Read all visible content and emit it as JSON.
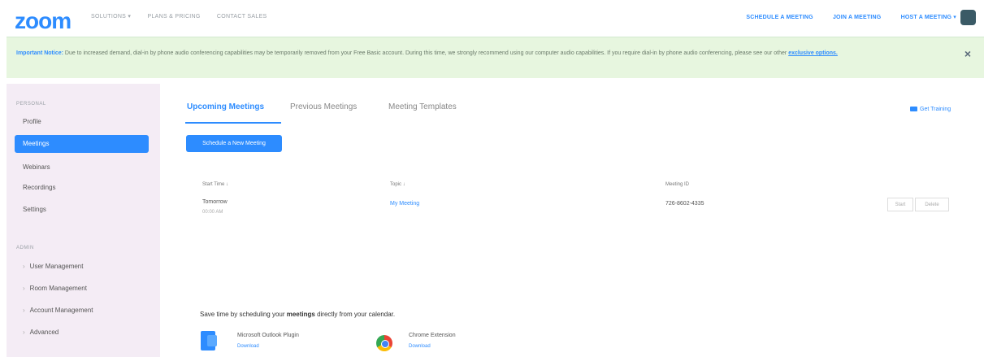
{
  "header": {
    "logo": "zoom",
    "nav": [
      "SOLUTIONS ▾",
      "PLANS & PRICING",
      "CONTACT SALES"
    ],
    "right_nav": [
      "SCHEDULE A MEETING",
      "JOIN A MEETING",
      "HOST A MEETING ▾"
    ]
  },
  "notice": {
    "title": "Important Notice:",
    "text": "Due to increased demand, dial-in by phone audio conferencing capabilities may be temporarily removed from your Free Basic account. During this time, we strongly recommend using our computer audio capabilities. If you require dial-in by phone audio conferencing, please see our other",
    "link": "exclusive options.",
    "close": "×"
  },
  "sidebar": {
    "personal_label": "PERSONAL",
    "personal_items": [
      "Profile",
      "Meetings",
      "Webinars",
      "Recordings",
      "Settings"
    ],
    "admin_label": "ADMIN",
    "admin_items": [
      "User Management",
      "Room Management",
      "Account Management",
      "Advanced"
    ]
  },
  "tabs": [
    "Upcoming Meetings",
    "Previous Meetings",
    "Meeting Templates"
  ],
  "get_training": "Get Training",
  "schedule_button": "Schedule a New Meeting",
  "table": {
    "headers": [
      "Start Time ↓",
      "Topic ↓",
      "Meeting ID"
    ],
    "rows": [
      {
        "day": "Tomorrow",
        "time": "00:00 AM",
        "topic": "My Meeting",
        "meeting_id": "726-8602-4335"
      }
    ],
    "actions": [
      "Start",
      "Delete"
    ]
  },
  "promo": {
    "text_pre": "Save time by scheduling your ",
    "text_bold": "meetings",
    "text_post": " directly from your calendar.",
    "plugins": [
      {
        "name": "Microsoft Outlook Plugin",
        "link": "Download",
        "icon": "outlook-icon"
      },
      {
        "name": "Chrome Extension",
        "link": "Download",
        "icon": "chrome-icon"
      }
    ]
  },
  "colors": {
    "accent": "#2d8cff",
    "notice_bg": "#e7f6df",
    "sidebar_bg": "#f4ecf5"
  }
}
